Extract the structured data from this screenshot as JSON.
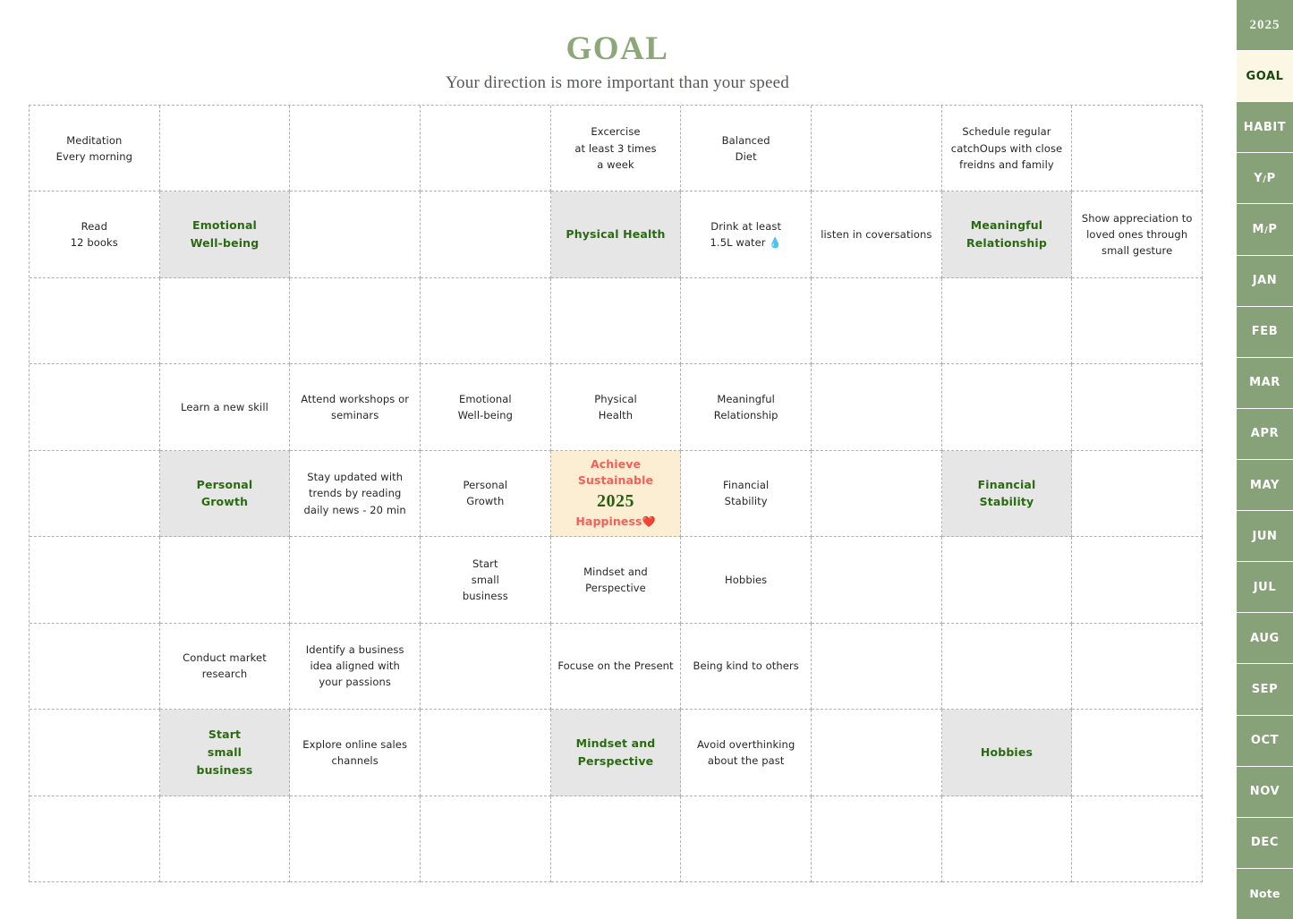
{
  "header": {
    "title": "GOAL",
    "subtitle": "Your direction is more important than your speed"
  },
  "colors": {
    "brand_green": "#8da878",
    "sidebar_green": "#87a178",
    "active_tab_bg": "#fcf6e4",
    "theme_cell_bg": "#e6e6e6",
    "theme_text": "#2a6a10",
    "center_cell_bg": "#fceed2",
    "center_text_red": "#f2605a",
    "center_year_green": "#2a5f10",
    "grid_line": "#b0b0b0"
  },
  "center_goal": {
    "line1": "Achieve Sustainable",
    "line2": "2025",
    "line3": "Happiness",
    "emoji": "❤️"
  },
  "grid": {
    "rows": 9,
    "cols": 9,
    "cells": [
      [
        {
          "text": "Meditation\nEvery morning",
          "type": "normal"
        },
        {
          "text": "",
          "type": "empty"
        },
        {
          "text": "",
          "type": "empty"
        },
        {
          "text": "",
          "type": "empty"
        },
        {
          "text": "Excercise\nat least 3 times\na week",
          "type": "normal"
        },
        {
          "text": "Balanced\nDiet",
          "type": "normal"
        },
        {
          "text": "",
          "type": "empty"
        },
        {
          "text": "Schedule regular\ncatchOups with close\nfreidns and family",
          "type": "normal"
        },
        {
          "text": "",
          "type": "empty"
        }
      ],
      [
        {
          "text": "Read\n12 books",
          "type": "normal"
        },
        {
          "text": "Emotional\nWell-being",
          "type": "theme"
        },
        {
          "text": "",
          "type": "empty"
        },
        {
          "text": "",
          "type": "empty"
        },
        {
          "text": "Physical Health",
          "type": "theme"
        },
        {
          "text": "Drink at least\n1.5L water 💧",
          "type": "normal"
        },
        {
          "text": "listen in coversations",
          "type": "normal"
        },
        {
          "text": "Meaningful\nRelationship",
          "type": "theme"
        },
        {
          "text": "Show appreciation to\nloved ones through\nsmall gesture",
          "type": "normal"
        }
      ],
      [
        {
          "text": "",
          "type": "empty"
        },
        {
          "text": "",
          "type": "empty"
        },
        {
          "text": "",
          "type": "empty"
        },
        {
          "text": "",
          "type": "empty"
        },
        {
          "text": "",
          "type": "empty"
        },
        {
          "text": "",
          "type": "empty"
        },
        {
          "text": "",
          "type": "empty"
        },
        {
          "text": "",
          "type": "empty"
        },
        {
          "text": "",
          "type": "empty"
        }
      ],
      [
        {
          "text": "",
          "type": "empty"
        },
        {
          "text": "Learn a new skill",
          "type": "normal"
        },
        {
          "text": "Attend workshops or\nseminars",
          "type": "normal"
        },
        {
          "text": "Emotional\nWell-being",
          "type": "normal"
        },
        {
          "text": "Physical\nHealth",
          "type": "normal"
        },
        {
          "text": "Meaningful\nRelationship",
          "type": "normal"
        },
        {
          "text": "",
          "type": "empty"
        },
        {
          "text": "",
          "type": "empty"
        },
        {
          "text": "",
          "type": "empty"
        }
      ],
      [
        {
          "text": "",
          "type": "empty"
        },
        {
          "text": "Personal\nGrowth",
          "type": "theme"
        },
        {
          "text": "Stay updated with\ntrends by reading\ndaily news - 20 min",
          "type": "normal"
        },
        {
          "text": "Personal\nGrowth",
          "type": "normal"
        },
        {
          "text": "",
          "type": "center"
        },
        {
          "text": "Financial\nStability",
          "type": "normal"
        },
        {
          "text": "",
          "type": "empty"
        },
        {
          "text": "Financial\nStability",
          "type": "theme"
        },
        {
          "text": "",
          "type": "empty"
        }
      ],
      [
        {
          "text": "",
          "type": "empty"
        },
        {
          "text": "",
          "type": "empty"
        },
        {
          "text": "",
          "type": "empty"
        },
        {
          "text": "Start\nsmall\nbusiness",
          "type": "normal"
        },
        {
          "text": "Mindset and\nPerspective",
          "type": "normal"
        },
        {
          "text": "Hobbies",
          "type": "normal"
        },
        {
          "text": "",
          "type": "empty"
        },
        {
          "text": "",
          "type": "empty"
        },
        {
          "text": "",
          "type": "empty"
        }
      ],
      [
        {
          "text": "",
          "type": "empty"
        },
        {
          "text": "Conduct market\nresearch",
          "type": "normal"
        },
        {
          "text": "Identify a business\nidea aligned with\nyour passions",
          "type": "normal"
        },
        {
          "text": "",
          "type": "empty"
        },
        {
          "text": "Focuse on the Present",
          "type": "normal"
        },
        {
          "text": "Being kind to others",
          "type": "normal"
        },
        {
          "text": "",
          "type": "empty"
        },
        {
          "text": "",
          "type": "empty"
        },
        {
          "text": "",
          "type": "empty"
        }
      ],
      [
        {
          "text": "",
          "type": "empty"
        },
        {
          "text": "Start\nsmall\nbusiness",
          "type": "theme"
        },
        {
          "text": "Explore online sales\nchannels",
          "type": "normal"
        },
        {
          "text": "",
          "type": "empty"
        },
        {
          "text": "Mindset and\nPerspective",
          "type": "theme"
        },
        {
          "text": "Avoid overthinking\nabout the past",
          "type": "normal"
        },
        {
          "text": "",
          "type": "empty"
        },
        {
          "text": "Hobbies",
          "type": "theme"
        },
        {
          "text": "",
          "type": "empty"
        }
      ],
      [
        {
          "text": "",
          "type": "empty"
        },
        {
          "text": "",
          "type": "empty"
        },
        {
          "text": "",
          "type": "empty"
        },
        {
          "text": "",
          "type": "empty"
        },
        {
          "text": "",
          "type": "empty"
        },
        {
          "text": "",
          "type": "empty"
        },
        {
          "text": "",
          "type": "empty"
        },
        {
          "text": "",
          "type": "empty"
        },
        {
          "text": "",
          "type": "empty"
        }
      ]
    ]
  },
  "sidebar": {
    "tabs": [
      {
        "label": "2025",
        "active": false,
        "style": "year"
      },
      {
        "label": "GOAL",
        "active": true,
        "style": "normal"
      },
      {
        "label": "HABIT",
        "active": false,
        "style": "normal"
      },
      {
        "label": "Y/P",
        "active": false,
        "style": "normal"
      },
      {
        "label": "M/P",
        "active": false,
        "style": "normal"
      },
      {
        "label": "JAN",
        "active": false,
        "style": "normal"
      },
      {
        "label": "FEB",
        "active": false,
        "style": "normal"
      },
      {
        "label": "MAR",
        "active": false,
        "style": "normal"
      },
      {
        "label": "APR",
        "active": false,
        "style": "normal"
      },
      {
        "label": "MAY",
        "active": false,
        "style": "normal"
      },
      {
        "label": "JUN",
        "active": false,
        "style": "normal"
      },
      {
        "label": "JUL",
        "active": false,
        "style": "normal"
      },
      {
        "label": "AUG",
        "active": false,
        "style": "normal"
      },
      {
        "label": "SEP",
        "active": false,
        "style": "normal"
      },
      {
        "label": "OCT",
        "active": false,
        "style": "normal"
      },
      {
        "label": "NOV",
        "active": false,
        "style": "normal"
      },
      {
        "label": "DEC",
        "active": false,
        "style": "normal"
      },
      {
        "label": "Note",
        "active": false,
        "style": "note"
      }
    ]
  }
}
